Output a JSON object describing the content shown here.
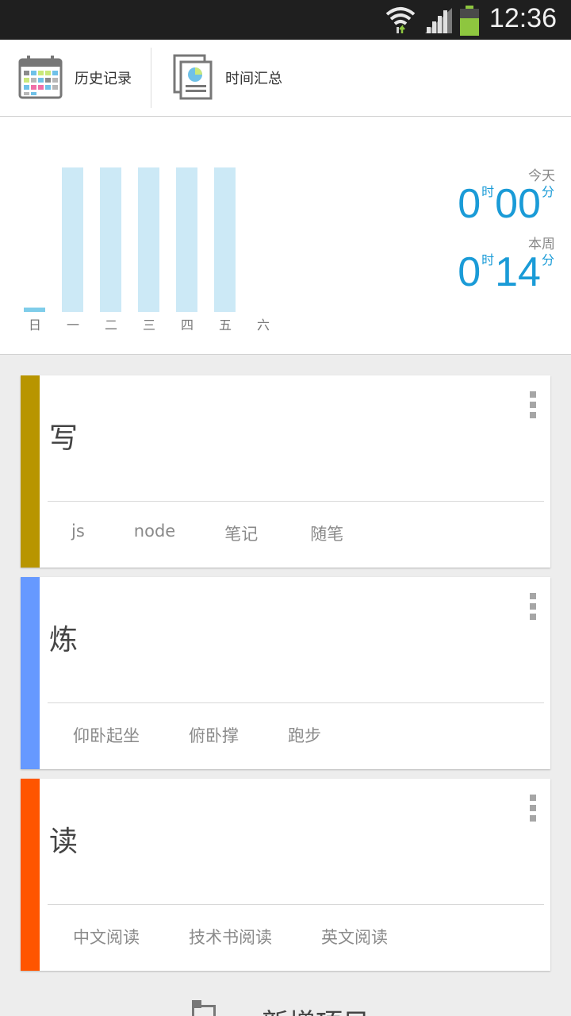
{
  "status_bar": {
    "time": "12:36"
  },
  "toolbar": {
    "history_label": "历史记录",
    "summary_label": "时间汇总"
  },
  "chart_data": {
    "type": "bar",
    "categories": [
      "日",
      "一",
      "二",
      "三",
      "四",
      "五",
      "六"
    ],
    "values": [
      0.03,
      1,
      1,
      1,
      1,
      1,
      0
    ],
    "ylim": [
      0,
      1
    ],
    "title": "",
    "xlabel": "",
    "ylabel": "",
    "colors": {
      "bar": "#cce9f6",
      "today_bar": "#7fcdea",
      "tick": "#777777"
    }
  },
  "stats": {
    "today_label": "今天",
    "today_hours": "0",
    "today_minutes": "00",
    "week_label": "本周",
    "week_hours": "0",
    "week_minutes": "14",
    "hour_unit": "时",
    "minute_unit": "分"
  },
  "cards": [
    {
      "title": "写",
      "color": "#b89500",
      "tags": [
        "js",
        "node",
        "笔记",
        "随笔"
      ]
    },
    {
      "title": "炼",
      "color": "#6699ff",
      "tags": [
        "仰卧起坐",
        "俯卧撑",
        "跑步"
      ]
    },
    {
      "title": "读",
      "color": "#ff5500",
      "tags": [
        "中文阅读",
        "技术书阅读",
        "英文阅读"
      ]
    }
  ],
  "add_project": {
    "label": "新增项目"
  },
  "icons": {
    "wifi": "wifi-icon",
    "signal": "signal-icon",
    "battery": "battery-icon",
    "calendar": "calendar-icon",
    "report": "report-icon",
    "more": "more-vert-icon",
    "add": "add-project-icon"
  }
}
